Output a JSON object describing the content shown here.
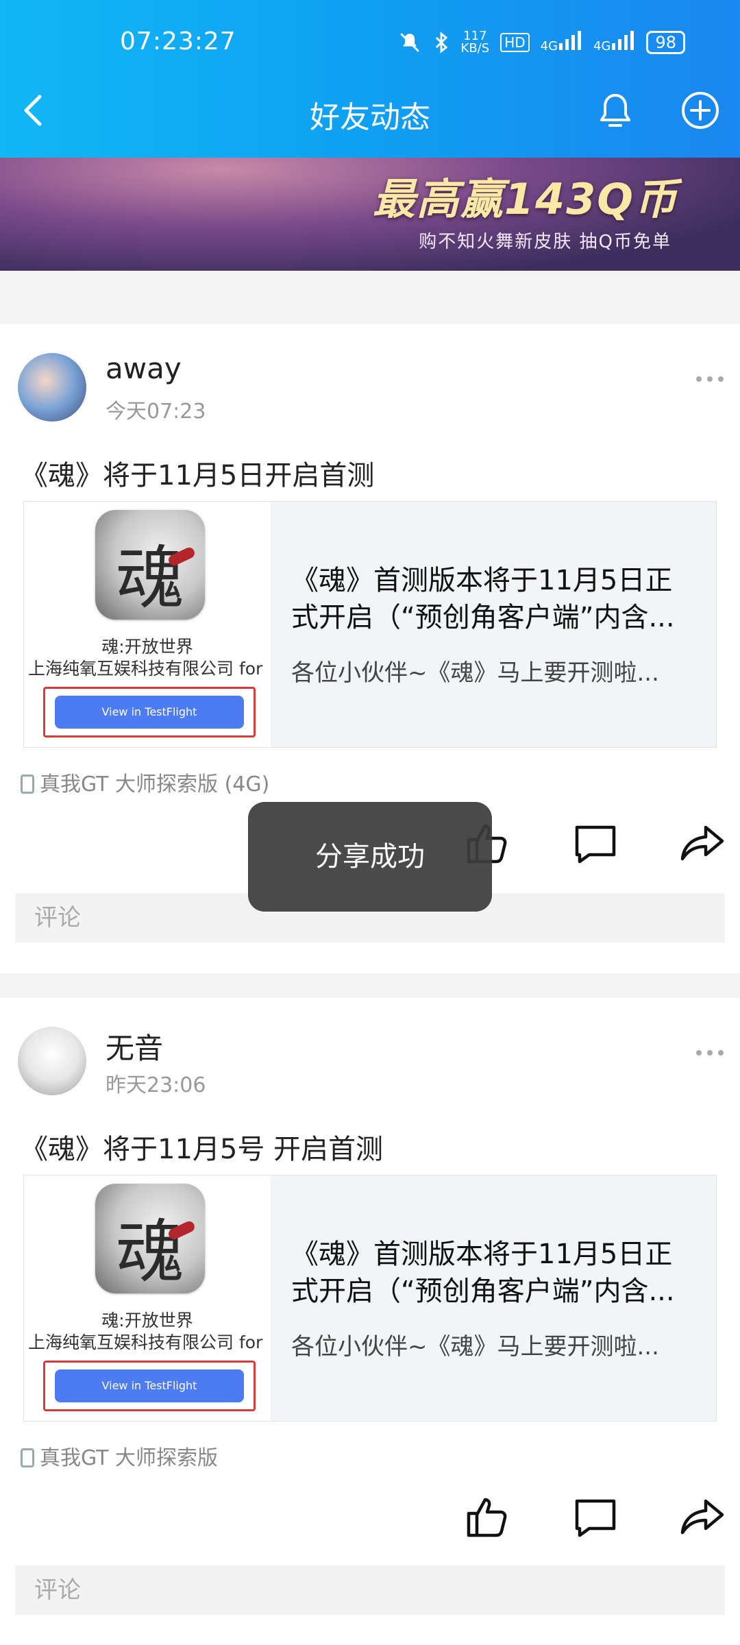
{
  "status_bar": {
    "time": "07:23:27",
    "net_speed": "117\nKB/S",
    "hd": "HD",
    "signal1": "4G",
    "signal2": "4G",
    "battery": "98"
  },
  "nav": {
    "title": "好友动态"
  },
  "banner": {
    "headline": "最高赢143Q币",
    "subline": "购不知火舞新皮肤 抽Q币免单"
  },
  "posts": [
    {
      "username": "away",
      "time": "今天07:23",
      "text": "《魂》将于11月5日开启首测",
      "share": {
        "game_name": "魂:开放世界",
        "company": "上海纯氧互娱科技有限公司 for iOS",
        "button": "View in TestFlight",
        "title": "《魂》首测版本将于11月5日正式开启（“预创角客户端”内含...",
        "desc": "各位小伙伴~《魂》马上要开测啦..."
      },
      "device": "真我GT 大师探索版 (4G)",
      "comment_placeholder": "评论"
    },
    {
      "username": "无音",
      "time": "昨天23:06",
      "text": "《魂》将于11月5号 开启首测",
      "share": {
        "game_name": "魂:开放世界",
        "company": "上海纯氧互娱科技有限公司 for iOS",
        "button": "View in TestFlight",
        "title": "《魂》首测版本将于11月5日正式开启（“预创角客户端”内含...",
        "desc": "各位小伙伴~《魂》马上要开测啦..."
      },
      "device": "真我GT 大师探索版",
      "comment_placeholder": "评论"
    }
  ],
  "toast": "分享成功"
}
